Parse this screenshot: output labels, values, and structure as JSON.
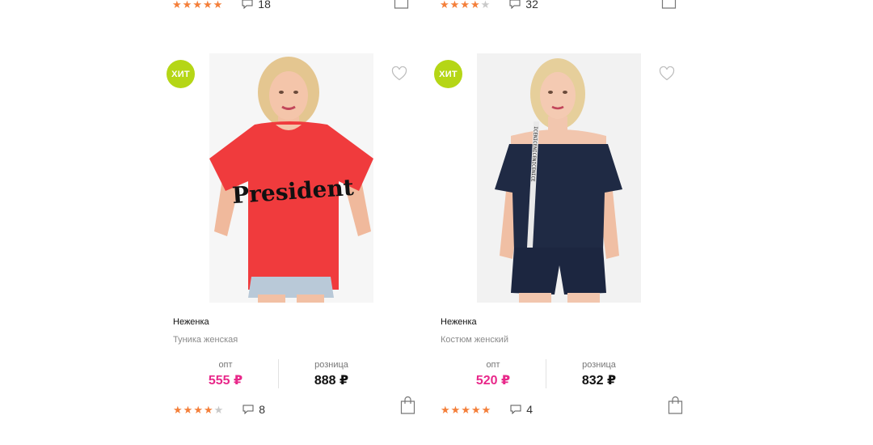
{
  "top_row": [
    {
      "rating": 5,
      "comments": "18"
    },
    {
      "rating": 4,
      "comments": "32"
    }
  ],
  "products": [
    {
      "badge": "ХИТ",
      "brand": "Неженка",
      "description": "Туника женская",
      "opt_label": "опт",
      "opt_price": "555 ₽",
      "retail_label": "розница",
      "retail_price": "888 ₽",
      "rating": 4,
      "comments": "8",
      "shirt_print": "President"
    },
    {
      "badge": "ХИТ",
      "brand": "Неженка",
      "description": "Костюм женский",
      "opt_label": "опт",
      "opt_price": "520 ₽",
      "retail_label": "розница",
      "retail_price": "832 ₽",
      "rating": 5,
      "comments": "4",
      "stripe_print": "ICENICENICENICENICE"
    }
  ],
  "colors": {
    "accent_price": "#e8288a",
    "badge": "#b5d616",
    "star_on": "#f47f3a",
    "star_off": "#c9c9c9"
  }
}
